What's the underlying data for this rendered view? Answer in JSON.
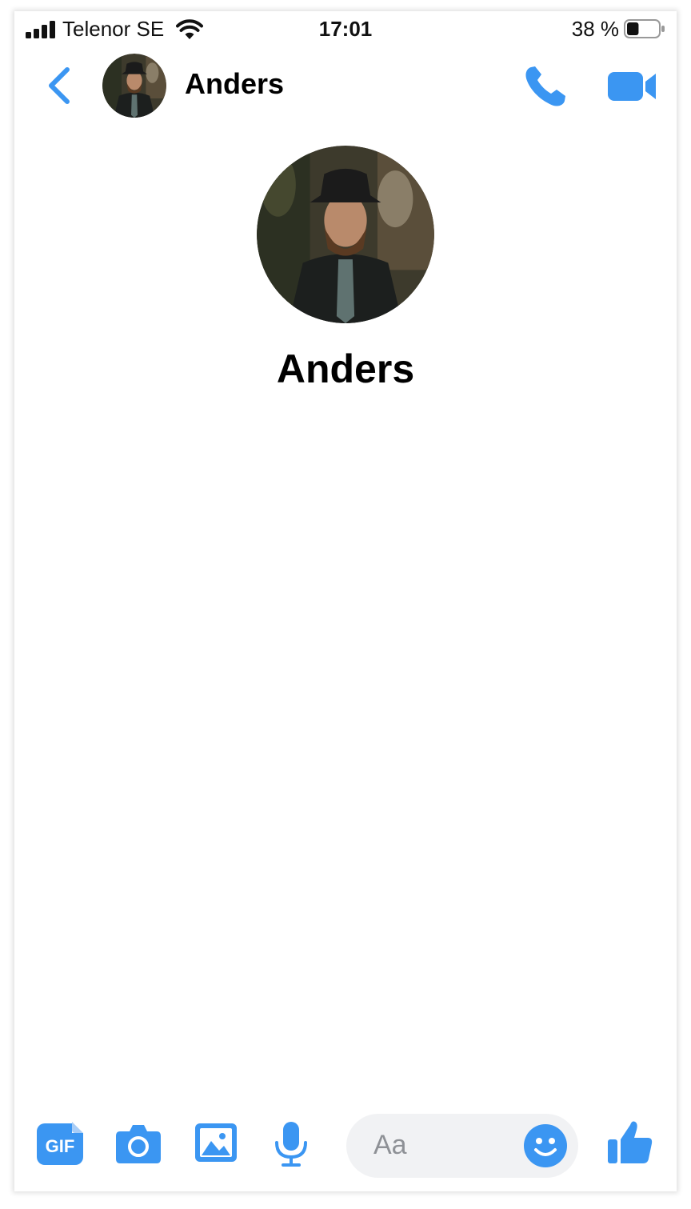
{
  "status_bar": {
    "carrier": "Telenor SE",
    "time": "17:01",
    "battery_percent": "38 %",
    "battery_level": 0.38,
    "signal_icon": "signal-bars-icon",
    "wifi_icon": "wifi-icon",
    "battery_icon": "battery-icon"
  },
  "header": {
    "contact_name": "Anders",
    "back_icon": "chevron-left-icon",
    "call_icon": "phone-icon",
    "video_icon": "video-camera-icon"
  },
  "profile": {
    "name": "Anders"
  },
  "composer": {
    "gif_label": "GIF",
    "placeholder": "Aa",
    "camera_icon": "camera-icon",
    "image_icon": "image-icon",
    "mic_icon": "microphone-icon",
    "emoji_icon": "smiley-icon",
    "like_icon": "thumbs-up-icon"
  },
  "colors": {
    "accent": "#3b96f2",
    "input_background": "#f1f2f4",
    "placeholder_text": "#8e9196"
  }
}
